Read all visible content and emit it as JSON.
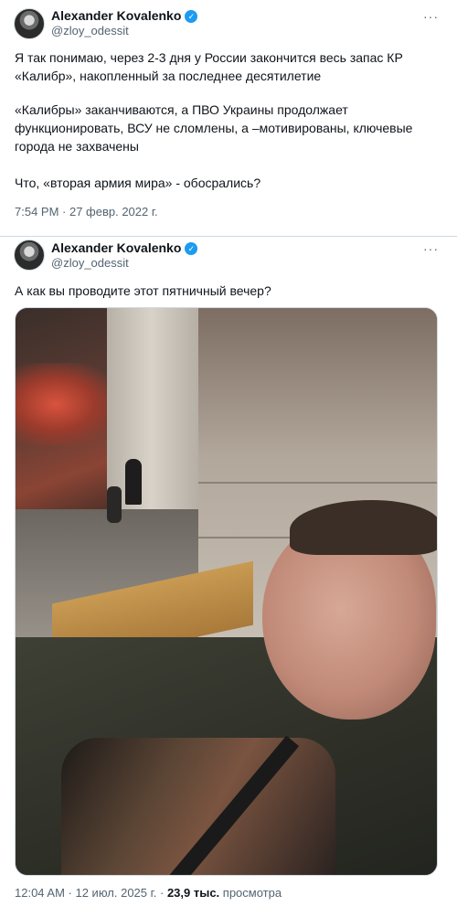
{
  "tweet1": {
    "author": "Alexander Kovalenko",
    "verified_icon": "✓",
    "handle": "@zloy_odessit",
    "more_icon": "···",
    "p1": "Я так понимаю, через 2-3 дня у России закончится весь запас КР «Калибр», накопленный за последнее десятилетие",
    "p2": "«Калибры» заканчиваются, а ПВО Украины продолжает функционировать, ВСУ не сломлены, а –мотивированы, ключевые города не захвачены",
    "p3": "Что, «вторая армия мира» - обосрались?",
    "timestamp": "7:54 PM · 27 февр. 2022 г."
  },
  "tweet2": {
    "author": "Alexander Kovalenko",
    "verified_icon": "✓",
    "handle": "@zloy_odessit",
    "more_icon": "···",
    "text": "А как вы проводите этот пятничный вечер?",
    "timestamp": "12:04 AM · 12 июл. 2025 г. · ",
    "views_count": "23,9 тыс.",
    "views_label": " просмотра"
  },
  "colors": {
    "accent": "#1d9bf0",
    "secondary_text": "#536471",
    "border": "#cfd9de"
  }
}
